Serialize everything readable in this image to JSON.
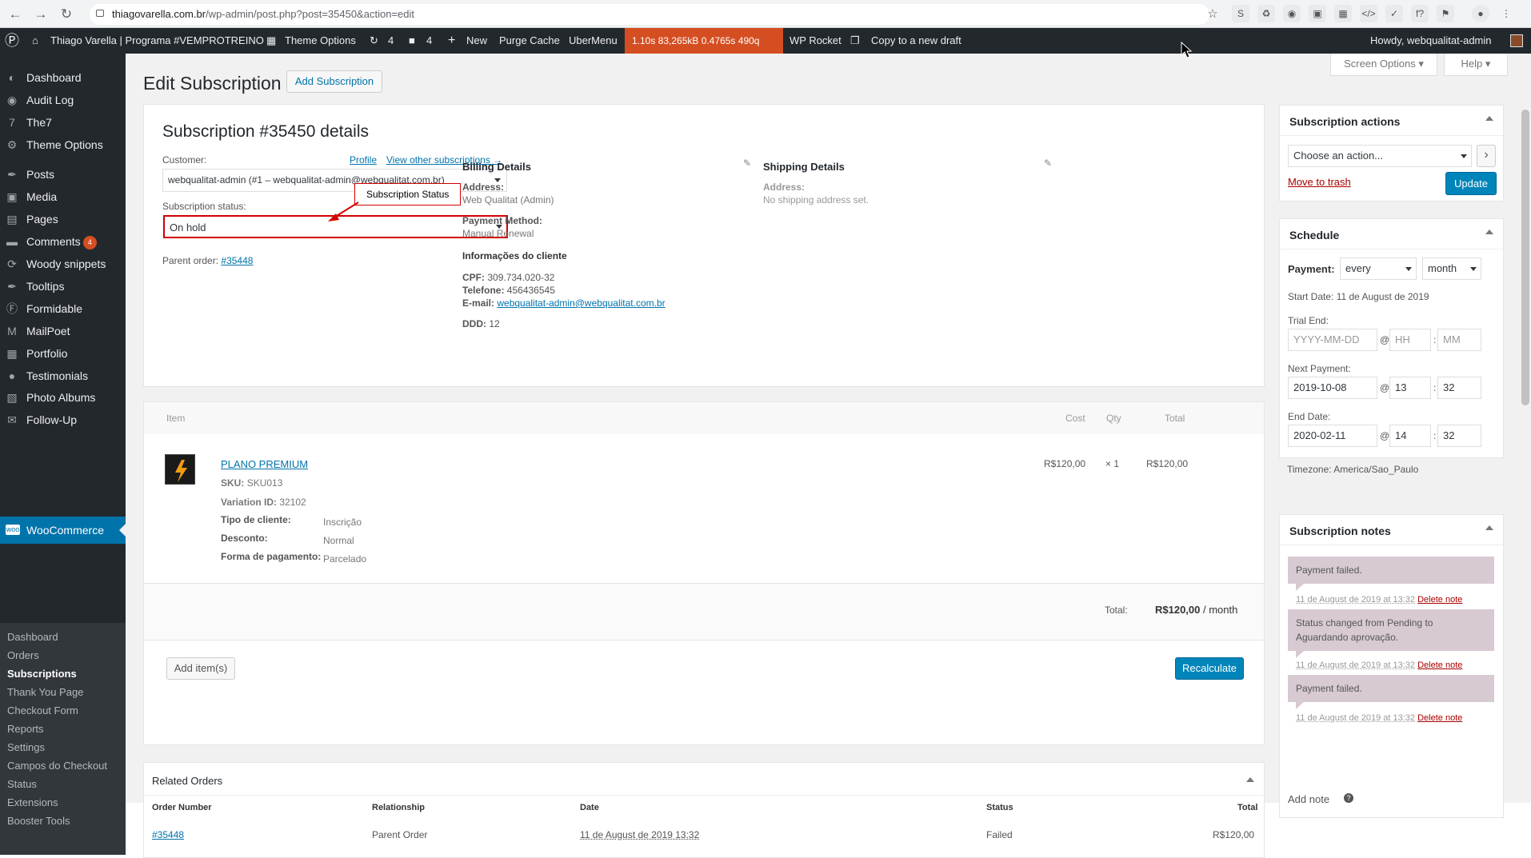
{
  "browser": {
    "url_host": "thiagovarella.com.br",
    "url_path": "/wp-admin/post.php?post=35450&action=edit"
  },
  "adminbar": {
    "site": "Thiago Varella | Programa #VEMPROTREINO",
    "theme_options": "Theme Options",
    "updates": "4",
    "comments": "4",
    "new": "New",
    "purge": "Purge Cache",
    "ubermenu": "UberMenu",
    "perf": "1.10s   83,265kB   0.4765s   490q",
    "rocket": "WP Rocket",
    "copy": "Copy to a new draft",
    "howdy": "Howdy, webqualitat-admin"
  },
  "sidebar": {
    "items": [
      {
        "label": "Dashboard",
        "icon": "dashboard-icon"
      },
      {
        "label": "Audit Log",
        "icon": "audit-icon"
      },
      {
        "label": "The7",
        "icon": "the7-icon"
      },
      {
        "label": "Theme Options",
        "icon": "gear-icon"
      },
      {
        "label": "Posts",
        "icon": "pin-icon"
      },
      {
        "label": "Media",
        "icon": "media-icon"
      },
      {
        "label": "Pages",
        "icon": "pages-icon"
      },
      {
        "label": "Comments",
        "icon": "comments-icon",
        "badge": "4"
      },
      {
        "label": "Woody snippets",
        "icon": "snippets-icon"
      },
      {
        "label": "Tooltips",
        "icon": "pin-icon"
      },
      {
        "label": "Formidable",
        "icon": "formidable-icon"
      },
      {
        "label": "MailPoet",
        "icon": "mailpoet-icon"
      },
      {
        "label": "Portfolio",
        "icon": "portfolio-icon"
      },
      {
        "label": "Testimonials",
        "icon": "testimonials-icon"
      },
      {
        "label": "Photo Albums",
        "icon": "albums-icon"
      },
      {
        "label": "Follow-Up",
        "icon": "mail-icon"
      }
    ],
    "woocommerce": "WooCommerce",
    "sub": [
      "Dashboard",
      "Orders",
      "Subscriptions",
      "Thank You Page",
      "Checkout Form",
      "Reports",
      "Settings",
      "Campos do Checkout",
      "Status",
      "Extensions",
      "Booster Tools"
    ]
  },
  "page": {
    "title": "Edit Subscription",
    "add_button": "Add Subscription",
    "screen_options": "Screen Options",
    "help": "Help"
  },
  "details": {
    "heading": "Subscription #35450 details",
    "customer_label": "Customer:",
    "profile": "Profile",
    "view_other": "View other subscriptions →",
    "customer_value": "webqualitat-admin (#1 – webqualitat-admin@webqualitat.com.br)",
    "status_label": "Subscription status:",
    "status_value": "On hold",
    "callout": "Subscription Status",
    "parent_label": "Parent order:",
    "parent_value": "#35448",
    "billing": {
      "heading": "Billing Details",
      "address_label": "Address:",
      "address_value": "Web Qualitat (Admin)",
      "payment_label": "Payment Method:",
      "payment_value": "Manual Renewal",
      "info_heading": "Informações do cliente",
      "cpf_label": "CPF:",
      "cpf_value": "309.734.020-32",
      "tel_label": "Telefone:",
      "tel_value": "456436545",
      "email_label": "E-mail:",
      "email_value": "webqualitat-admin@webqualitat.com.br",
      "ddd_label": "DDD:",
      "ddd_value": "12"
    },
    "shipping": {
      "heading": "Shipping Details",
      "address_label": "Address:",
      "address_value": "No shipping address set."
    }
  },
  "items": {
    "headers": {
      "item": "Item",
      "cost": "Cost",
      "qty": "Qty",
      "total": "Total"
    },
    "product": {
      "name": "PLANO PREMIUM",
      "sku_label": "SKU:",
      "sku": "SKU013",
      "variation_label": "Variation ID:",
      "variation": "32102",
      "meta": [
        {
          "label": "Tipo de cliente:",
          "value": "Inscrição"
        },
        {
          "label": "Desconto:",
          "value": "Normal"
        },
        {
          "label": "Forma de pagamento:",
          "value": "Parcelado"
        }
      ],
      "cost": "R$120,00",
      "qty": "× 1",
      "total": "R$120,00"
    },
    "total_label": "Total:",
    "total_value": "R$120,00",
    "total_period": " / month",
    "add_items": "Add item(s)",
    "recalculate": "Recalculate"
  },
  "related": {
    "heading": "Related Orders",
    "headers": [
      "Order Number",
      "Relationship",
      "Date",
      "Status",
      "Total"
    ],
    "row": [
      "#35448",
      "Parent Order",
      "11 de August de 2019 13:32",
      "Failed",
      "R$120,00"
    ]
  },
  "actions": {
    "heading": "Subscription actions",
    "select": "Choose an action...",
    "go": "›",
    "trash": "Move to trash",
    "update": "Update"
  },
  "schedule": {
    "heading": "Schedule",
    "payment_label": "Payment:",
    "interval": "every",
    "period": "month",
    "start_date": "Start Date: 11 de August de 2019",
    "trial_label": "Trial End:",
    "trial_date_ph": "YYYY-MM-DD",
    "trial_hh_ph": "HH",
    "trial_mm_ph": "MM",
    "next_label": "Next Payment:",
    "next_date": "2019-10-08",
    "next_hh": "13",
    "next_mm": "32",
    "end_label": "End Date:",
    "end_date": "2020-02-11",
    "end_hh": "14",
    "end_mm": "32",
    "at": "@",
    "colon": ":",
    "timezone": "Timezone: America/Sao_Paulo"
  },
  "notes": {
    "heading": "Subscription notes",
    "list": [
      {
        "text": "Payment failed.",
        "meta": "11 de August de 2019 at 13:32",
        "delete": "Delete note"
      },
      {
        "text": "Status changed from Pending to Aguardando aprovação.",
        "meta": "11 de August de 2019 at 13:32",
        "delete": "Delete note"
      },
      {
        "text": "Payment failed.",
        "meta": "11 de August de 2019 at 13:32",
        "delete": "Delete note"
      }
    ],
    "add_note": "Add note"
  },
  "colors": {
    "accent": "#0073aa",
    "adminbar": "#23282d",
    "perf": "#d54e21",
    "callout": "#d20000"
  }
}
